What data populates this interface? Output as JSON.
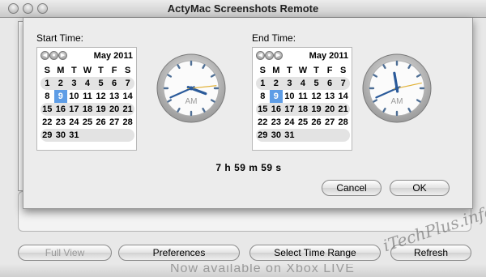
{
  "window": {
    "title": "ActyMac Screenshots Remote"
  },
  "sheet": {
    "start_label": "Start Time:",
    "end_label": "End Time:",
    "duration": "7 h 59 m 59 s",
    "cancel_label": "Cancel",
    "ok_label": "OK"
  },
  "calendar_start": {
    "month": "May 2011",
    "days_header": [
      "S",
      "M",
      "T",
      "W",
      "T",
      "F",
      "S"
    ],
    "weeks": [
      [
        "1",
        "2",
        "3",
        "4",
        "5",
        "6",
        "7"
      ],
      [
        "8",
        "9",
        "10",
        "11",
        "12",
        "13",
        "14"
      ],
      [
        "15",
        "16",
        "17",
        "18",
        "19",
        "20",
        "21"
      ],
      [
        "22",
        "23",
        "24",
        "25",
        "26",
        "27",
        "28"
      ],
      [
        "29",
        "30",
        "31",
        "",
        "",
        "",
        ""
      ]
    ],
    "selected_day": "9"
  },
  "calendar_end": {
    "month": "May 2011",
    "days_header": [
      "S",
      "M",
      "T",
      "W",
      "T",
      "F",
      "S"
    ],
    "weeks": [
      [
        "1",
        "2",
        "3",
        "4",
        "5",
        "6",
        "7"
      ],
      [
        "8",
        "9",
        "10",
        "11",
        "12",
        "13",
        "14"
      ],
      [
        "15",
        "16",
        "17",
        "18",
        "19",
        "20",
        "21"
      ],
      [
        "22",
        "23",
        "24",
        "25",
        "26",
        "27",
        "28"
      ],
      [
        "29",
        "30",
        "31",
        "",
        "",
        "",
        ""
      ]
    ],
    "selected_day": "9"
  },
  "clock_start": {
    "ampm": "AM",
    "hour": 3,
    "minute": 41,
    "second": 14
  },
  "clock_end": {
    "ampm": "AM",
    "hour": 11,
    "minute": 41,
    "second": 13
  },
  "bottom_buttons": {
    "full_view": "Full View",
    "preferences": "Preferences",
    "select_time_range": "Select Time Range",
    "refresh": "Refresh"
  },
  "background": {
    "strip_text": "Now available on Xbox LIVE"
  },
  "watermark": {
    "text": "iTechPlus.info"
  },
  "colors": {
    "selection": "#5e9de6",
    "second_hand": "#e2b33a",
    "hand": "#2a5a9a"
  }
}
